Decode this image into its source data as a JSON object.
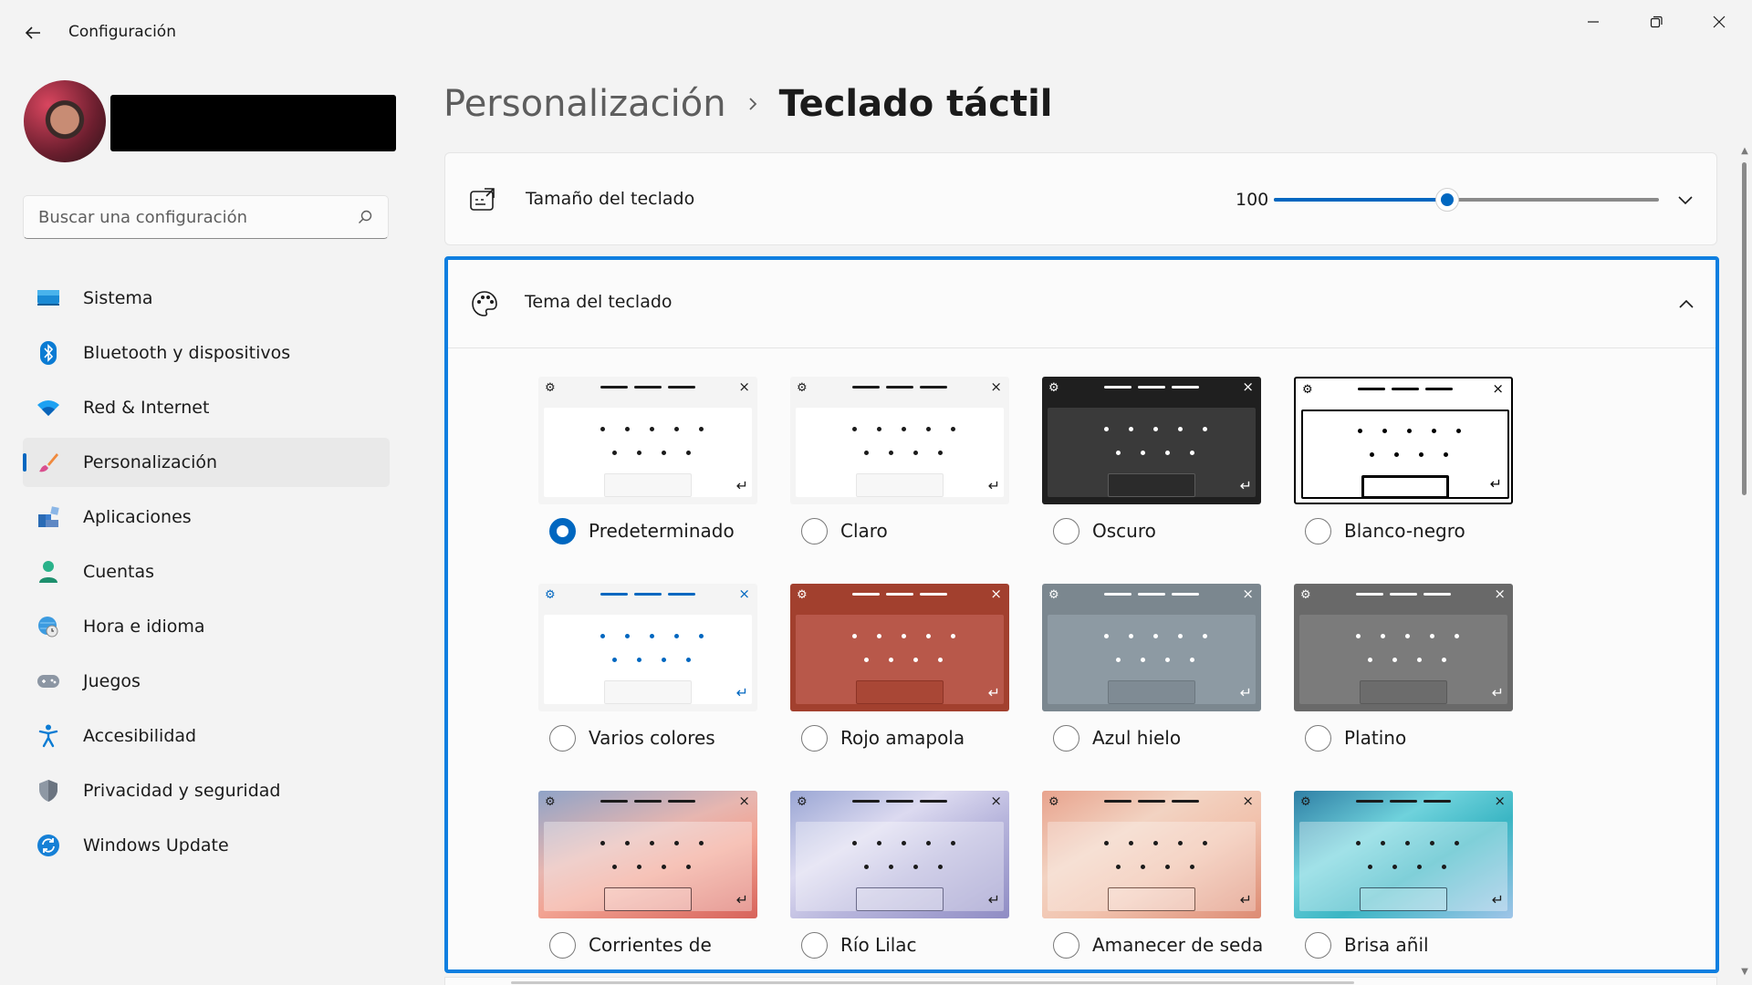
{
  "app": {
    "title": "Configuración"
  },
  "search": {
    "placeholder": "Buscar una configuración"
  },
  "sidebar": {
    "items": [
      {
        "label": "Sistema",
        "icon": "monitor-icon"
      },
      {
        "label": "Bluetooth y dispositivos",
        "icon": "bluetooth-icon"
      },
      {
        "label": "Red & Internet",
        "icon": "wifi-icon"
      },
      {
        "label": "Personalización",
        "icon": "brush-icon",
        "active": true
      },
      {
        "label": "Aplicaciones",
        "icon": "apps-icon"
      },
      {
        "label": "Cuentas",
        "icon": "person-icon"
      },
      {
        "label": "Hora e idioma",
        "icon": "globe-clock-icon"
      },
      {
        "label": "Juegos",
        "icon": "gamepad-icon"
      },
      {
        "label": "Accesibilidad",
        "icon": "accessibility-icon"
      },
      {
        "label": "Privacidad y seguridad",
        "icon": "shield-icon"
      },
      {
        "label": "Windows Update",
        "icon": "sync-icon"
      }
    ]
  },
  "breadcrumb": {
    "parent": "Personalización",
    "separator": "›",
    "current": "Teclado táctil"
  },
  "keyboard_size": {
    "label": "Tamaño del teclado",
    "value": "100",
    "slider_fraction": 0.45
  },
  "keyboard_theme": {
    "label": "Tema del teclado",
    "themes": [
      {
        "label": "Predeterminado",
        "checked": true,
        "bg": "#f4f4f4",
        "body": "#ffffff",
        "ink": "#1b1b1b",
        "space": "#f7f7f7",
        "spaceBorder": "#e6e6e6"
      },
      {
        "label": "Claro",
        "checked": false,
        "bg": "#f4f4f4",
        "body": "#ffffff",
        "ink": "#1b1b1b",
        "space": "#f7f7f7",
        "spaceBorder": "#e6e6e6"
      },
      {
        "label": "Oscuro",
        "checked": false,
        "bg": "#1f1f1f",
        "body": "#3a3a3a",
        "ink": "#ffffff",
        "space": "#2b2b2b",
        "spaceBorder": "#5a5a5a"
      },
      {
        "label": "Blanco-negro",
        "checked": false,
        "bg": "#ffffff",
        "body": "#ffffff",
        "ink": "#000000",
        "space": "#ffffff",
        "spaceBorder": "#000000",
        "outline": true
      },
      {
        "label": "Varios colores",
        "checked": false,
        "bg": "#f4f4f4",
        "body": "#ffffff",
        "ink": "#0067c0",
        "space": "#f7f7f7",
        "spaceBorder": "#e6e6e6"
      },
      {
        "label": "Rojo amapola",
        "checked": false,
        "bg": "#a2402e",
        "body": "#b8584a",
        "ink": "#ffffff",
        "space": "#a94736",
        "spaceBorder": "#8c3426"
      },
      {
        "label": "Azul hielo",
        "checked": false,
        "bg": "#7b878f",
        "body": "#8d9aa3",
        "ink": "#ffffff",
        "space": "#7f8b94",
        "spaceBorder": "#6c777f"
      },
      {
        "label": "Platino",
        "checked": false,
        "bg": "#696969",
        "body": "#7b7b7b",
        "ink": "#ffffff",
        "space": "#6c6c6c",
        "spaceBorder": "#5a5a5a"
      },
      {
        "label": "Corrientes de",
        "checked": false,
        "gradient": "linear-gradient(160deg,#8fa3c7 0%,#e7b6b0 40%,#f2a392 60%,#d7625a 100%)",
        "body": "rgba(255,255,255,0.35)",
        "ink": "#1b1b1b",
        "space": "rgba(255,255,255,0.2)",
        "spaceBorder": "#6b4a4a"
      },
      {
        "label": "Río Lilac",
        "checked": false,
        "gradient": "linear-gradient(150deg,#9aa6d4 0%,#dcdaf0 35%,#b7b5dc 60%,#8f8cc4 100%)",
        "body": "rgba(255,255,255,0.35)",
        "ink": "#1b1b1b",
        "space": "rgba(255,255,255,0.2)",
        "spaceBorder": "#6b6b8a"
      },
      {
        "label": "Amanecer de seda",
        "checked": false,
        "gradient": "linear-gradient(150deg,#e8a38d 0%,#f2d3c2 35%,#f1c2ad 60%,#dd8b73 100%)",
        "body": "rgba(255,255,255,0.3)",
        "ink": "#1b1b1b",
        "space": "rgba(255,255,255,0.2)",
        "spaceBorder": "#7a5a4e"
      },
      {
        "label": "Brisa añil",
        "checked": false,
        "gradient": "linear-gradient(150deg,#2f7fa5 0%,#6fd2dc 35%,#3bb6c4 60%,#9fc4e8 100%)",
        "body": "rgba(255,255,255,0.35)",
        "ink": "#1b1b1b",
        "space": "rgba(255,255,255,0.2)",
        "spaceBorder": "#3d5f6e"
      }
    ]
  },
  "colors": {
    "accent": "#0067c0",
    "focus_border": "#0f7fe0"
  }
}
